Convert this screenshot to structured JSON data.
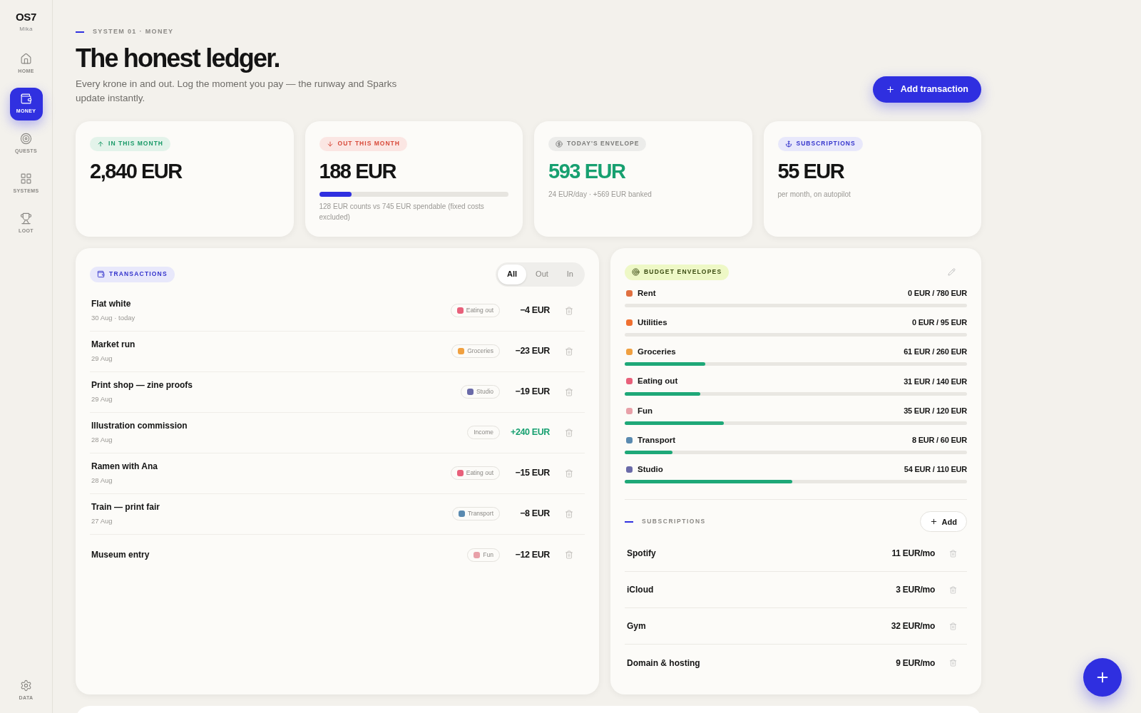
{
  "brand": {
    "logo": "OS7",
    "user": "Mika"
  },
  "nav": [
    {
      "label": "HOME",
      "selected": false
    },
    {
      "label": "MONEY",
      "selected": true
    },
    {
      "label": "QUESTS",
      "selected": false
    },
    {
      "label": "SYSTEMS",
      "selected": false
    },
    {
      "label": "LOOT",
      "selected": false
    }
  ],
  "nav_bottom": {
    "label": "DATA"
  },
  "header": {
    "eyebrow": "SYSTEM 01 · MONEY",
    "title": "The honest ledger.",
    "subtitle": "Every krone in and out. Log the moment you pay — the runway and Sparks update instantly.",
    "action": "Add transaction"
  },
  "stats": [
    {
      "kind": "in",
      "label": "IN THIS MONTH",
      "value": "2,840 EUR"
    },
    {
      "kind": "out",
      "label": "OUT THIS MONTH",
      "value": "188 EUR",
      "level": 0.17,
      "note": "128 EUR counts vs 745 EUR spendable (fixed costs excluded)"
    },
    {
      "kind": "envelope",
      "label": "TODAY'S ENVELOPE",
      "value": "593 EUR",
      "note": "24 EUR/day · +569 EUR banked"
    },
    {
      "kind": "subs",
      "label": "SUBSCRIPTIONS",
      "value": "55 EUR",
      "note": "per month, on autopilot"
    }
  ],
  "transactions": {
    "title": "TRANSACTIONS",
    "filters": [
      {
        "label": "All",
        "selected": true
      },
      {
        "label": "Out",
        "selected": false
      },
      {
        "label": "In",
        "selected": false
      }
    ],
    "rows": [
      {
        "name": "Flat white",
        "date": "30 Aug · today",
        "tag": "Eating out",
        "color": "#e8607a",
        "amount": "−4 EUR",
        "income": false
      },
      {
        "name": "Market run",
        "date": "29 Aug",
        "tag": "Groceries",
        "color": "#f0a040",
        "amount": "−23 EUR",
        "income": false
      },
      {
        "name": "Print shop — zine proofs",
        "date": "29 Aug",
        "tag": "Studio",
        "color": "#6a6aa8",
        "amount": "−19 EUR",
        "income": false
      },
      {
        "name": "Illustration commission",
        "date": "28 Aug",
        "tag": "Income",
        "amount": "+240 EUR",
        "income": true
      },
      {
        "name": "Ramen with Ana",
        "date": "28 Aug",
        "tag": "Eating out",
        "color": "#e8607a",
        "amount": "−15 EUR",
        "income": false
      },
      {
        "name": "Train — print fair",
        "date": "27 Aug",
        "tag": "Transport",
        "color": "#5a8ab0",
        "amount": "−8 EUR",
        "income": false
      },
      {
        "name": "Museum entry",
        "tag": "Fun",
        "color": "#e8a0a8",
        "amount": "−12 EUR",
        "income": false
      }
    ]
  },
  "envelopes": {
    "title": "BUDGET ENVELOPES",
    "items": [
      {
        "name": "Rent",
        "color": "#e07040",
        "amount": "0 EUR / 780 EUR",
        "level": 0
      },
      {
        "name": "Utilities",
        "color": "#f07030",
        "amount": "0 EUR / 95 EUR",
        "level": 0
      },
      {
        "name": "Groceries",
        "color": "#f0a040",
        "amount": "61 EUR / 260 EUR",
        "level": 0.235
      },
      {
        "name": "Eating out",
        "color": "#e8607a",
        "amount": "31 EUR / 140 EUR",
        "level": 0.22
      },
      {
        "name": "Fun",
        "color": "#e8a0a8",
        "amount": "35 EUR / 120 EUR",
        "level": 0.29
      },
      {
        "name": "Transport",
        "color": "#5a8ab0",
        "amount": "8 EUR / 60 EUR",
        "level": 0.14
      },
      {
        "name": "Studio",
        "color": "#6a6aa8",
        "amount": "54 EUR / 110 EUR",
        "level": 0.49
      }
    ]
  },
  "subscriptions": {
    "title": "SUBSCRIPTIONS",
    "add": "Add",
    "rows": [
      {
        "name": "Spotify",
        "amount": "11 EUR/mo"
      },
      {
        "name": "iCloud",
        "amount": "3 EUR/mo"
      },
      {
        "name": "Gym",
        "amount": "32 EUR/mo"
      },
      {
        "name": "Domain & hosting",
        "amount": "9 EUR/mo"
      }
    ]
  }
}
